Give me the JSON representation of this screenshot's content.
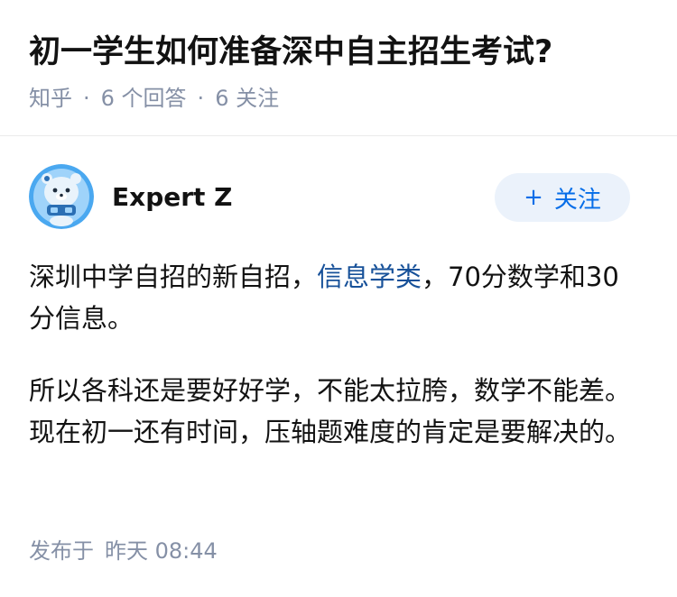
{
  "question": {
    "title": "初一学生如何准备深中自主招生考试?",
    "source": "知乎",
    "answer_count": "6 个回答",
    "follower_count": "6 关注",
    "separator": "·"
  },
  "author": {
    "name": "Expert Z",
    "avatar_icon": "bear-mascot-avatar-icon",
    "follow_plus": "+",
    "follow_label": "关注"
  },
  "answer": {
    "p1_before": "深圳中学自招的新自招，",
    "p1_link": "信息学类",
    "p1_after": "，70分数学和30分信息。",
    "p2": "所以各科还是要好好学，不能太拉胯，数学不能差。现在初一还有时间，压轴题难度的肯定是要解决的。"
  },
  "footer": {
    "published_label": "发布于",
    "published_time": "昨天 08:44"
  },
  "colors": {
    "link": "#175199",
    "meta": "#8590a6",
    "follow_text": "#056de8",
    "follow_bg": "#ebf2fb"
  }
}
